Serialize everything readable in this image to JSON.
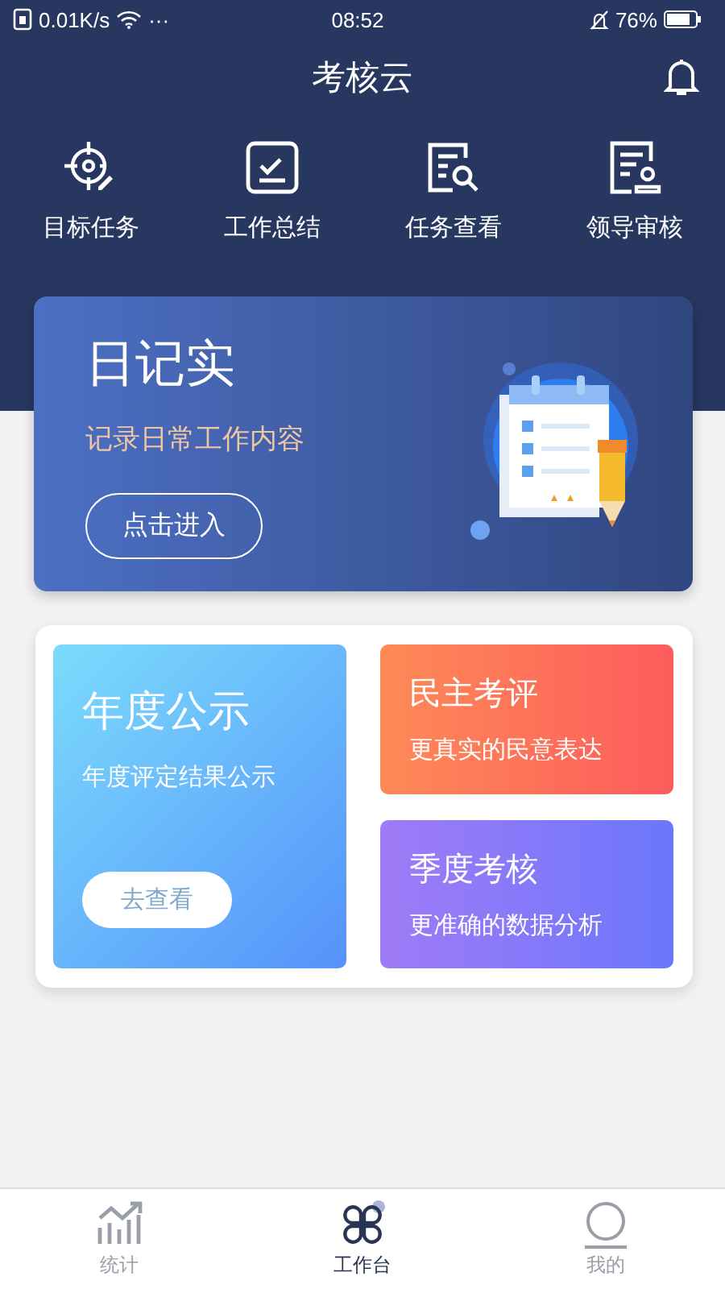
{
  "status_bar": {
    "speed": "0.01K/s",
    "more": "···",
    "time": "08:52",
    "battery": "76%"
  },
  "header": {
    "title": "考核云"
  },
  "shortcuts": [
    {
      "kind": "target",
      "label": "目标任务"
    },
    {
      "kind": "check",
      "label": "工作总结"
    },
    {
      "kind": "search",
      "label": "任务查看"
    },
    {
      "kind": "review",
      "label": "领导审核"
    }
  ],
  "banner": {
    "title": "日记实",
    "subtitle": "记录日常工作内容",
    "button": "点击进入"
  },
  "cards": [
    {
      "kind": "blue",
      "title": "年度公示",
      "subtitle": "年度评定结果公示",
      "button": "去查看"
    },
    {
      "kind": "orange",
      "title": "民主考评",
      "subtitle": "更真实的民意表达"
    },
    {
      "kind": "purple",
      "title": "季度考核",
      "subtitle": "更准确的数据分析"
    }
  ],
  "tab_bar": [
    {
      "kind": "stats",
      "label": "统计",
      "selected": false
    },
    {
      "kind": "work",
      "label": "工作台",
      "selected": true
    },
    {
      "kind": "me",
      "label": "我的",
      "selected": false
    }
  ]
}
